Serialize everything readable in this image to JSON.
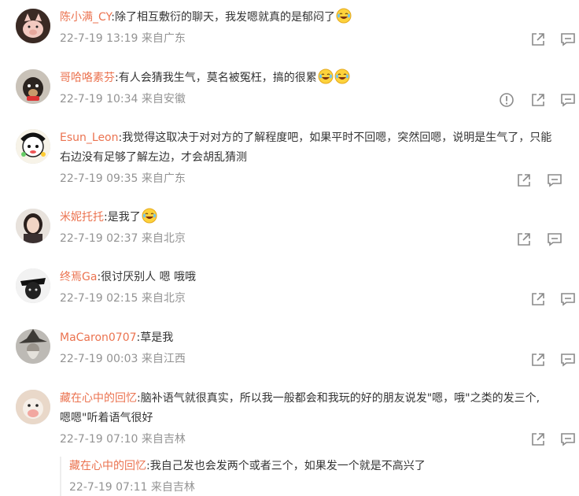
{
  "comments": [
    {
      "user": "陈小满_CY",
      "text": "除了相互敷衍的聊天，我发嗯就真的是郁闷了",
      "emojis": 1,
      "time": "22-7-19 13:19 来自广东",
      "avatar": "pig-avatar"
    },
    {
      "user": "哥哈咯素芬",
      "text": "有人会猜我生气，莫名被冤枉，搞的很累",
      "emojis": 2,
      "time": "22-7-19 10:34 来自安徽",
      "avatar": "dog-avatar"
    },
    {
      "user": "Esun_Leon",
      "text": "我觉得这取决于对对方的了解程度吧，如果平时不回嗯，突然回嗯，说明是生气了，只能",
      "text2": "右边没有足够了解左边，才会胡乱猜测",
      "emojis": 0,
      "time": "22-7-19 09:35 来自广东",
      "avatar": "cartoon-avatar"
    },
    {
      "user": "米妮托托",
      "text": "是我了",
      "emojis": 1,
      "time": "22-7-19 02:37 来自北京",
      "avatar": "girl-avatar"
    },
    {
      "user": "终焉Ga",
      "text": "很讨厌别人 嗯 哦哦",
      "emojis": 0,
      "time": "22-7-19 02:15 来自北京",
      "avatar": "dark-avatar"
    },
    {
      "user": "MaCaron0707",
      "text": "草是我",
      "emojis": 0,
      "time": "22-7-19 00:03 来自江西",
      "avatar": "wizard-avatar"
    },
    {
      "user": "藏在心中的回忆",
      "text": "脑补语气就很真实，所以我一般都会和我玩的好的朋友说发\"嗯，哦\"之类的发三个,",
      "text2": "嗯嗯\"听着语气很好",
      "emojis": 0,
      "time": "22-7-19 07:10 来自吉林",
      "avatar": "toy-avatar"
    }
  ],
  "reply": {
    "user": "藏在心中的回忆",
    "text": "我自己发也会发两个或者三个，如果发一个就是不高兴了",
    "time": "22-7-19 07:11 来自吉林"
  },
  "colors": {
    "username": "#eb7350",
    "meta": "#939393",
    "icon": "#8a8a8a"
  },
  "icons": {
    "share": "share-icon",
    "comment": "comment-icon",
    "report": "report-icon",
    "emoji": "laughing-emoji"
  }
}
